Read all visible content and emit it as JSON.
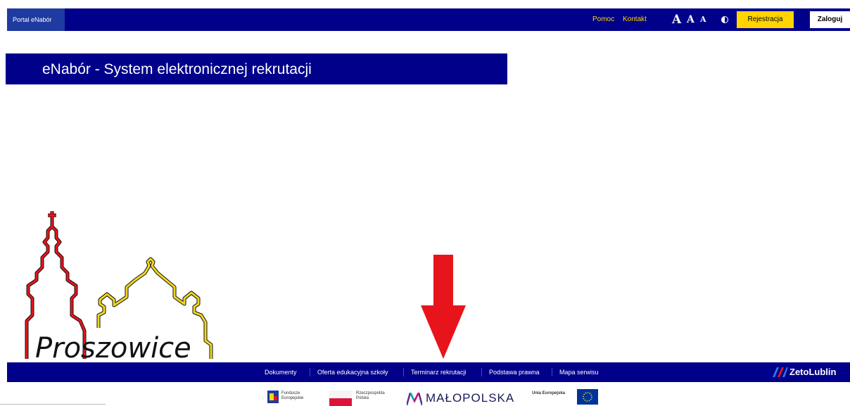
{
  "topbar": {
    "brand": "Portal eNabór",
    "links": [
      "Pomoc",
      "Kontakt"
    ],
    "font_sizes": [
      "A",
      "A",
      "A"
    ],
    "register_label": "Rejestracja",
    "login_label": "Zaloguj"
  },
  "banner": {
    "title": "eNabór - System elektronicznej rekrutacji"
  },
  "logo": {
    "text": "Proszowice"
  },
  "footer": {
    "links": [
      "Dokumenty",
      "Oferta edukacyjna szkoły",
      "Terminarz rekrutacji",
      "Podstawa prawna",
      "Mapa serwisu"
    ],
    "vendor": "ZetoLublin"
  },
  "funding": {
    "fe": [
      "Fundusze",
      "Europejskie"
    ],
    "rp": [
      "Rzeczpospolita",
      "Polska"
    ],
    "malopolska": "MAŁOPOLSKA",
    "ue": "Unia Europejska"
  },
  "colors": {
    "navy": "#00008b",
    "yellow": "#ffd400",
    "arrow_red": "#e8141c"
  }
}
